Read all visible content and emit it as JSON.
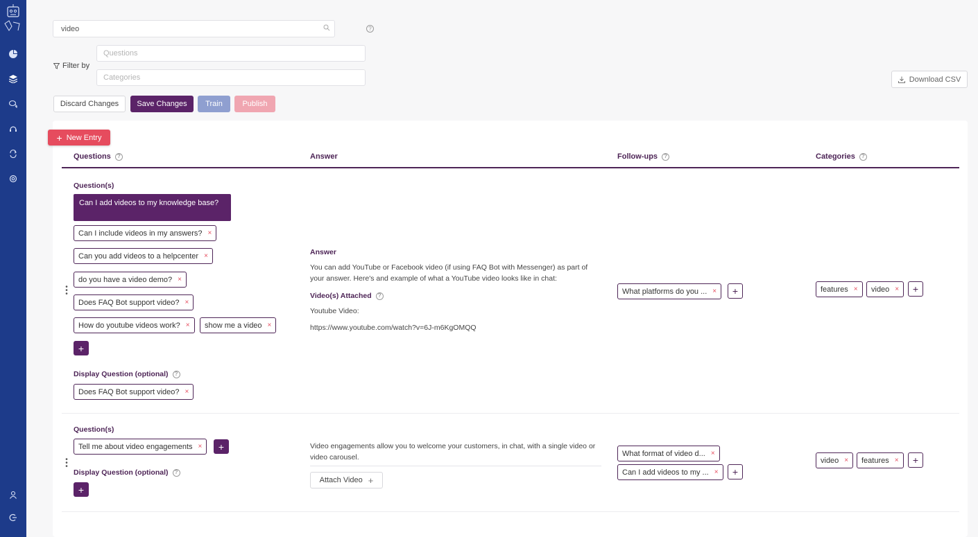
{
  "search": {
    "value": "video",
    "placeholder": ""
  },
  "filter": {
    "label": "Filter by",
    "questions_placeholder": "Questions",
    "categories_placeholder": "Categories"
  },
  "toolbar": {
    "discard": "Discard Changes",
    "save": "Save Changes",
    "train": "Train",
    "publish": "Publish",
    "download": "Download CSV",
    "new_entry": "New Entry"
  },
  "table": {
    "headers": {
      "questions": "Questions",
      "answer": "Answer",
      "followups": "Follow-ups",
      "categories": "Categories"
    }
  },
  "entry1": {
    "questions_label": "Question(s)",
    "active_question": "Can I add videos to my knowledge base?",
    "questions": [
      "Can I include videos in my answers?",
      "Can you add videos to a helpcenter",
      "do you have a video demo?",
      "Does FAQ Bot support video?",
      "How do youtube videos work?",
      "show me a video"
    ],
    "display_question_label": "Display Question (optional)",
    "display_question": "Does FAQ Bot support video?",
    "answer_label": "Answer",
    "answer_line1": "You can add YouTube or Facebook video (if using FAQ Bot with Messenger) as part of",
    "answer_line2": "your answer. Here's and example of what a YouTube video looks like in chat:",
    "videos_label": "Video(s) Attached",
    "video_type": "Youtube Video:",
    "video_url": "https://www.youtube.com/watch?v=6J-m6KgOMQQ",
    "followups": [
      "What platforms do you ..."
    ],
    "categories": [
      "features",
      "video"
    ]
  },
  "entry2": {
    "questions_label": "Question(s)",
    "questions": [
      "Tell me about video engagements"
    ],
    "display_question_label": "Display Question (optional)",
    "answer_line1": "Video engagements allow you to welcome your customers, in chat, with a single video or",
    "answer_line2": "video carousel.",
    "attach_label": "Attach Video",
    "followups": [
      "What format of video d...",
      "Can I add videos to my ..."
    ],
    "categories": [
      "video",
      "features"
    ]
  },
  "icons": {
    "x": "×",
    "plus": "+",
    "help": "?"
  },
  "colors": {
    "primary": "#5b2368",
    "accent": "#e64c5e",
    "sidebar": "#1d3b8a",
    "train": "#8f9fd0",
    "publish": "#f0a6b1"
  }
}
